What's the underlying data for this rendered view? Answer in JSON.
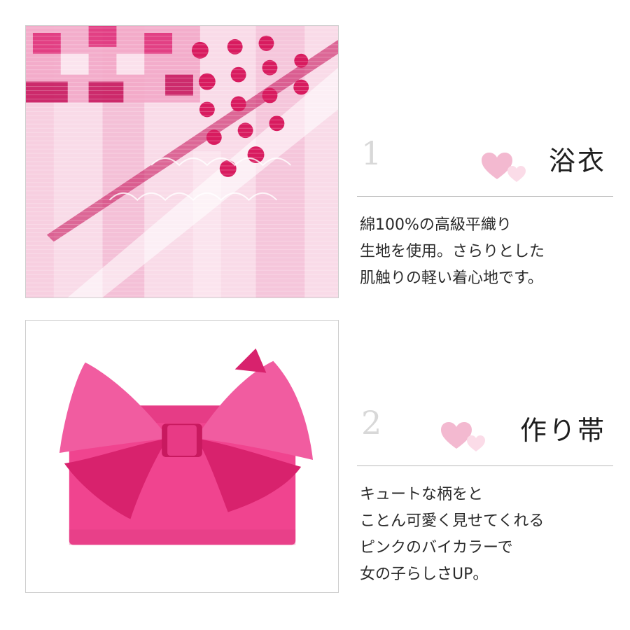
{
  "colors": {
    "heart_pink": "#f3b9d0",
    "heart_light": "#fbdce8",
    "fabric_pink": "#f6c8dc",
    "dot_magenta": "#d81b5f",
    "obi_pink": "#f0448f",
    "obi_dark": "#c8195f"
  },
  "photos": {
    "fabric": "pink-white-yukata-fabric-closeup",
    "obi": "pink-bow-tsukuri-obi"
  },
  "features": [
    {
      "number": "1",
      "title": "浴衣",
      "icon": "hearts-icon",
      "lines": [
        "綿100%の高級平織り",
        "生地を使用。さらりとした",
        "肌触りの軽い着心地です。"
      ]
    },
    {
      "number": "2",
      "title": "作り帯",
      "icon": "hearts-icon",
      "lines": [
        "キュートな柄をと",
        "ことん可愛く見せてくれる",
        "ピンクのバイカラーで",
        "女の子らしさUP。"
      ]
    }
  ]
}
